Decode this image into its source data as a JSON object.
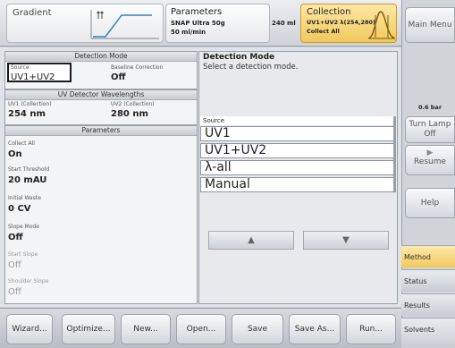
{
  "top": {
    "gradient_label": "Gradient",
    "parameters_title": "Parameters",
    "parameters_line1": "SNAP Ultra 50g",
    "parameters_line2": "50 ml/min",
    "volume": "240 ml",
    "collection_title": "Collection",
    "collection_line1": "UV1+UV2  λ(254,280)",
    "collection_line2": "Collect All"
  },
  "left": {
    "detection_mode_header": "Detection Mode",
    "source_label": "Source",
    "source_value": "UV1+UV2",
    "baseline_label": "Baseline Correction",
    "baseline_value": "Off",
    "uv_header": "UV Detector Wavelengths",
    "uv1_label": "UV1 (Collection)",
    "uv1_value": "254 nm",
    "uv2_label": "UV2 (Collection)",
    "uv2_value": "280 nm",
    "params_header": "Parameters",
    "collect_all_label": "Collect All",
    "collect_all_value": "On",
    "start_threshold_label": "Start Threshold",
    "start_threshold_value": "20 mAU",
    "initial_waste_label": "Initial Waste",
    "initial_waste_value": "0 CV",
    "slope_mode_label": "Slope Mode",
    "slope_mode_value": "Off",
    "start_slope_label": "Start Slope",
    "start_slope_value": "Off",
    "shoulder_slope_label": "Shoulder Slope",
    "shoulder_slope_value": "Off"
  },
  "right": {
    "title": "Detection Mode",
    "subtitle": "Select a detection mode.",
    "source_label": "Source",
    "options": [
      "UV1",
      "UV1+UV2",
      "λ-all",
      "Manual"
    ]
  },
  "bottom": {
    "wizard": "Wizard...",
    "optimize": "Optimize...",
    "new": "New...",
    "open": "Open...",
    "save": "Save",
    "save_as": "Save As...",
    "run": "Run..."
  },
  "side": {
    "main_menu": "Main Menu",
    "pressure": "0.6 bar",
    "turn_lamp_off": "Turn Lamp Off",
    "resume": "Resume",
    "help": "Help",
    "tab_method": "Method",
    "tab_status": "Status",
    "tab_results": "Results",
    "tab_solvents": "Solvents"
  },
  "colors": {
    "accent": "#f2c85c",
    "panel": "#f3f4f6"
  }
}
